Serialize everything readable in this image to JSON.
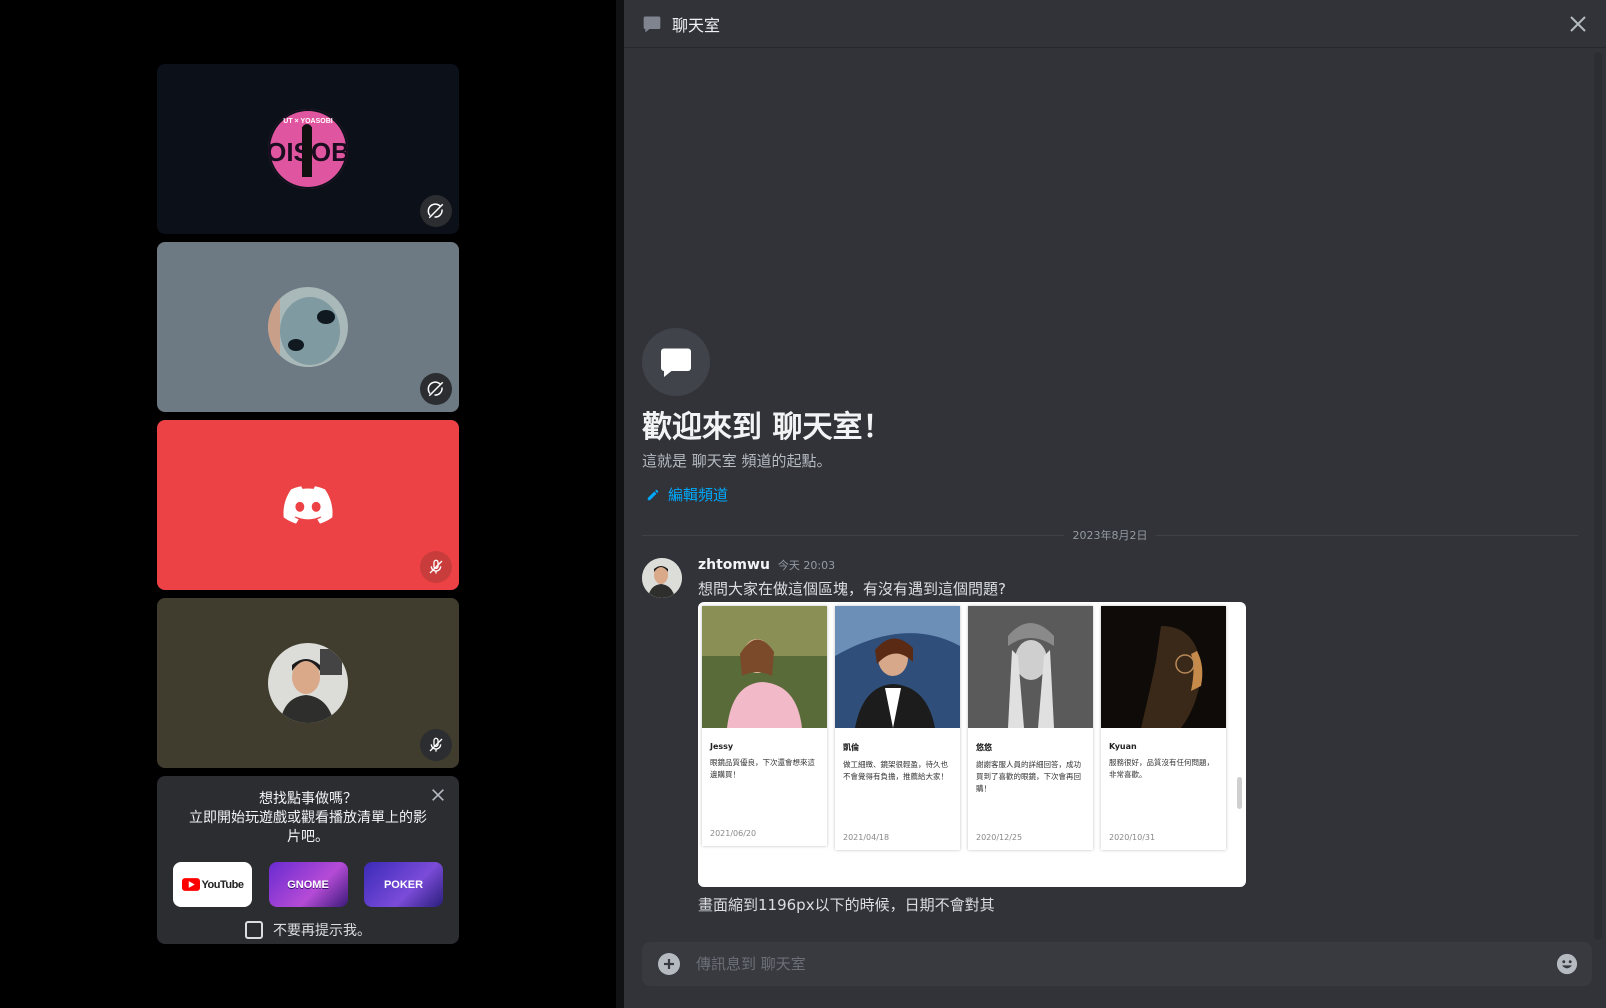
{
  "stage": {
    "tiles": [
      {
        "name": "user-tile-1",
        "avatar_text": "UT × YOASOBI",
        "avatar_big": "OISOB",
        "status": "screen-off"
      },
      {
        "name": "user-tile-2",
        "status": "screen-off"
      },
      {
        "name": "user-tile-3",
        "status": "muted"
      },
      {
        "name": "user-tile-4",
        "status": "muted"
      }
    ],
    "activity": {
      "line1": "想找點事做嗎？",
      "line2": "立即開始玩遊戲或觀看播放清單上的影",
      "line3": "片吧。",
      "apps": [
        "YouTube",
        "GNOME",
        "POKER"
      ],
      "dont_show": "不要再提示我。"
    }
  },
  "chat": {
    "header_title": "聊天室",
    "welcome_title": "歡迎來到 聊天室！",
    "welcome_sub": "這就是 聊天室 頻道的起點。",
    "edit_channel": "編輯頻道",
    "date_divider": "2023年8月2日",
    "message": {
      "user": "zhtomwu",
      "time": "今天 20:03",
      "text": "想問大家在做這個區塊，有沒有遇到這個問題?",
      "text2": "畫面縮到1196px以下的時候，日期不會對其",
      "cards": [
        {
          "name": "Jessy",
          "review": "眼鏡品質優良，下次還會想來這邊購買！",
          "date": "2021/06/20"
        },
        {
          "name": "凱倫",
          "review": "做工細緻、鏡架很輕盈，待久也不會覺得有負擔，推薦給大家！",
          "date": "2021/04/18"
        },
        {
          "name": "悠悠",
          "review": "謝謝客服人員的詳細回答，成功買到了喜歡的眼鏡，下次會再回購！",
          "date": "2020/12/25"
        },
        {
          "name": "Kyuan",
          "review": "服務很好，品質沒有任何問題，非常喜歡。",
          "date": "2020/10/31"
        }
      ]
    },
    "composer_placeholder": "傳訊息到 聊天室"
  },
  "colors": {
    "accent_link": "#00a8fc",
    "discord_red": "#ed4245",
    "panel": "#313338"
  }
}
